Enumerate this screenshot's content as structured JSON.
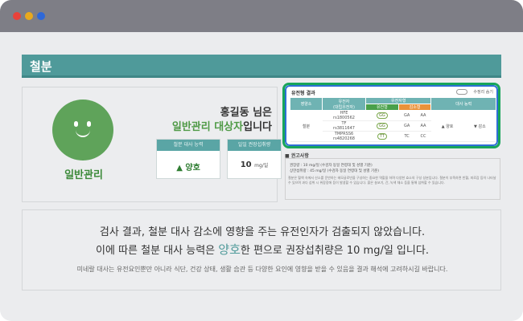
{
  "section": {
    "title": "철분"
  },
  "profile": {
    "greeting": "홍길동 님은",
    "status_green": "일반관리 대상자",
    "status_suffix": "입니다",
    "avatar_label": "일반관리"
  },
  "metrics": [
    {
      "label": "철분 대사 능력",
      "value": "▲ 양호",
      "unit": ""
    },
    {
      "label": "일일 권장섭취량",
      "value": "10",
      "unit": "mg/일"
    }
  ],
  "results": {
    "title": "유전형 결과",
    "toggle_label": "수정리 숨기",
    "headers": {
      "nutrient": "영양소",
      "gene": "유전자",
      "gene_sub": "(대립유전자)",
      "genotype": "유전자형",
      "my_type": "유전형",
      "risk_type": "감소형",
      "ability": "대사 능력"
    },
    "row": {
      "nutrient": "철분",
      "genes": [
        {
          "name": "HFE",
          "rs": "rs1800562",
          "my": "GG",
          "risk1": "GA",
          "risk2": "AA"
        },
        {
          "name": "TF",
          "rs": "rs3811647",
          "my": "GG",
          "risk1": "GA",
          "risk2": "AA"
        },
        {
          "name": "TMPRSS6",
          "rs": "rs4820268",
          "my": "TT",
          "risk1": "TC",
          "risk2": "CC"
        }
      ],
      "ability_good": "▲ 양호",
      "ability_low": "▼ 감소"
    }
  },
  "recommendation": {
    "title": "■ 권고사항",
    "line1": "권장량 : 10 mg/일 (수검자 동일 연령대 및 성별 기준)",
    "line2": "상한섭취량 : 45 mg/일 (수검자 동일 연령대 및 성별 기준)",
    "paragraph": "철분은 혈액 속에서 산소를 운반하는 헤모글로빈을 구성하는 중요한 역할을 하며 다양한 효소의 구성 성분입니다. 철분이 부족하면 빈혈, 피로감 등이 나타날 수 있으며 과다 섭취 시 위장장애 등이 발생할 수 있습니다. 붉은 살코기, 간, 녹색 채소 등을 통해 섭취할 수 있습니다."
  },
  "summary": {
    "line1": "검사 결과, 철분 대사 감소에 영향을 주는 유전인자가 검출되지 않았습니다.",
    "line2_prefix": "이에 따른 철분 대사 능력은 ",
    "line2_highlight": "양호",
    "line2_suffix": "한 편으로 권장섭취량은 10 mg/일 입니다.",
    "note": "미네랄 대사는 유전요인뿐만 아니라 식단, 건강 상태, 생활 습관 등 다양한 요인에 영향을 받을 수 있음을 결과 해석에 고려하시길 바랍니다."
  }
}
